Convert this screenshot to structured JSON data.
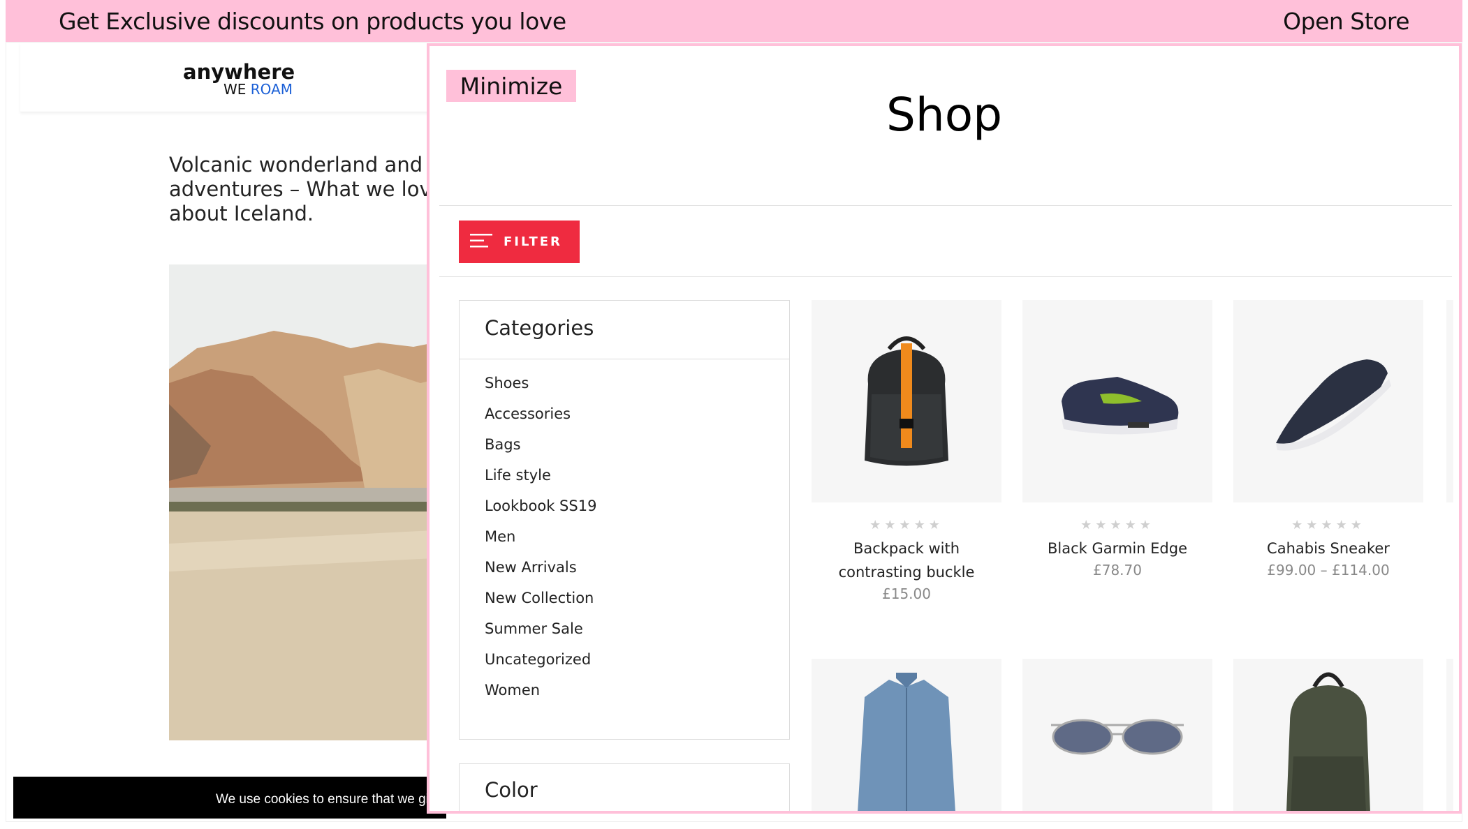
{
  "promo_bar": {
    "text": "Get Exclusive discounts on products you love",
    "action": "Open Store"
  },
  "background_site": {
    "logo_top": "anywhere",
    "logo_we": "WE",
    "logo_roam": "ROAM",
    "article_title": "Volcanic wonderland and adventures – What we love about Iceland.",
    "cookie_text": "We use cookies to ensure that we give you the best experience on our website."
  },
  "shop_modal": {
    "minimize_label": "Minimize",
    "title": "Shop",
    "filter_label": "FILTER",
    "categories": {
      "title": "Categories",
      "items": [
        "Shoes",
        "Accessories",
        "Bags",
        "Life style",
        "Lookbook SS19",
        "Men",
        "New Arrivals",
        "New Collection",
        "Summer Sale",
        "Uncategorized",
        "Women"
      ]
    },
    "color_filter_title": "Color",
    "products": [
      {
        "name": "Backpack with contrasting buckle",
        "price": "£15.00",
        "rating": 0,
        "image": "backpack"
      },
      {
        "name": "Black Garmin Edge",
        "price": "£78.70",
        "rating": 0,
        "image": "sneaker"
      },
      {
        "name": "Cahabis Sneaker",
        "price": "£99.00 – £114.00",
        "rating": 0,
        "image": "slip-on-shoe"
      },
      {
        "image": "denim-shirt"
      },
      {
        "image": "sunglasses"
      },
      {
        "image": "green-backpack"
      }
    ]
  },
  "colors": {
    "promo_pink": "#ffc0d9",
    "filter_red": "#ef2b40",
    "logo_blue": "#1a5fd6"
  }
}
